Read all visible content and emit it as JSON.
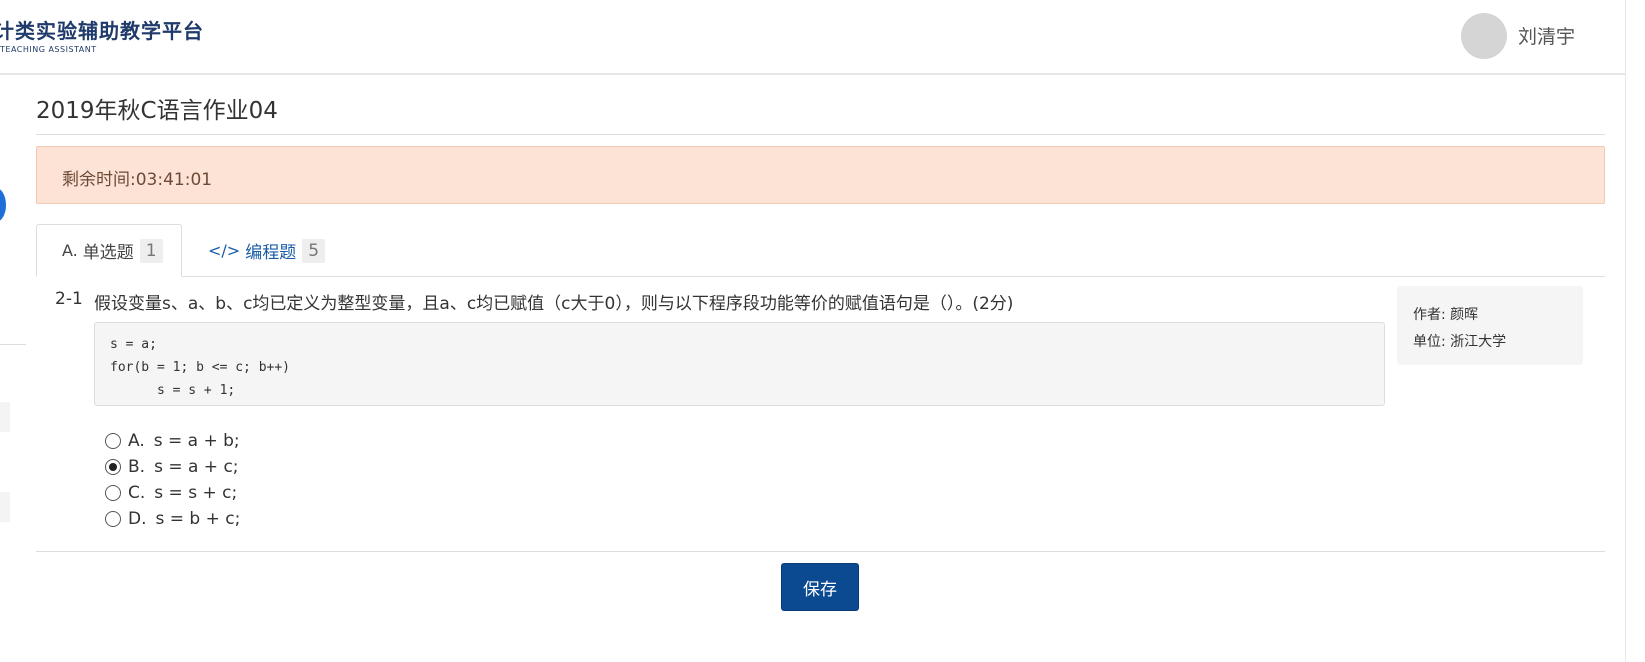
{
  "header": {
    "logo_main": "计类实验辅助教学平台",
    "logo_sub": "TEACHING ASSISTANT",
    "username": "刘清宇"
  },
  "page": {
    "title": "2019年秋C语言作业04",
    "timer": "剩余时间:03:41:01"
  },
  "tabs": [
    {
      "icon": "A.",
      "label": "单选题",
      "count": "1",
      "active": true
    },
    {
      "icon": "</>",
      "label": "编程题",
      "count": "5",
      "active": false
    }
  ],
  "question": {
    "number": "2-1",
    "text": "假设变量s、a、b、c均已定义为整型变量，且a、c均已赋值（c大于0），则与以下程序段功能等价的赋值语句是（）。(2分)",
    "code": "s = a;\nfor(b = 1; b <= c; b++)\n      s = s + 1;",
    "options": [
      {
        "letter": "A.",
        "text": "s = a + b;",
        "selected": false
      },
      {
        "letter": "B.",
        "text": "s = a + c;",
        "selected": true
      },
      {
        "letter": "C.",
        "text": "s = s + c;",
        "selected": false
      },
      {
        "letter": "D.",
        "text": "s = b + c;",
        "selected": false
      }
    ]
  },
  "author": {
    "author_line": "作者: 颜晖",
    "unit_line": "单位: 浙江大学"
  },
  "actions": {
    "save_label": "保存"
  },
  "colors": {
    "brand": "#0b4a91",
    "banner_bg": "#fce3d6",
    "logo": "#1f3a6b"
  }
}
